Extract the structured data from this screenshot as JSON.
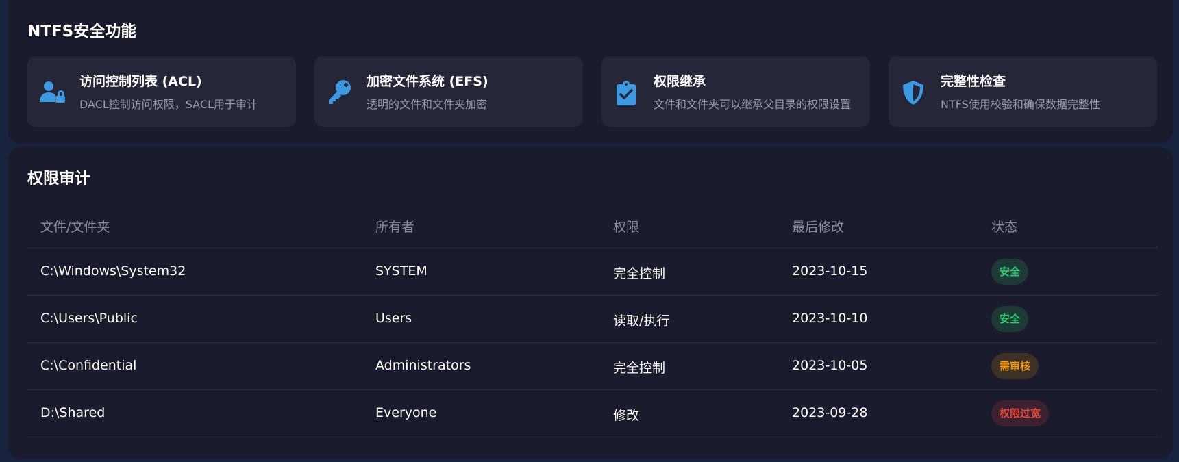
{
  "features": {
    "title": "NTFS安全功能",
    "cards": [
      {
        "icon": "user-lock-icon",
        "title": "访问控制列表 (ACL)",
        "desc": "DACL控制访问权限，SACL用于审计"
      },
      {
        "icon": "key-icon",
        "title": "加密文件系统 (EFS)",
        "desc": "透明的文件和文件夹加密"
      },
      {
        "icon": "clipboard-check-icon",
        "title": "权限继承",
        "desc": "文件和文件夹可以继承父目录的权限设置"
      },
      {
        "icon": "shield-icon",
        "title": "完整性检查",
        "desc": "NTFS使用校验和确保数据完整性"
      }
    ],
    "icon_color": "#3b9ae1"
  },
  "audit": {
    "title": "权限审计",
    "columns": [
      "文件/文件夹",
      "所有者",
      "权限",
      "最后修改",
      "状态"
    ],
    "rows": [
      {
        "path": "C:\\Windows\\System32",
        "owner": "SYSTEM",
        "permission": "完全控制",
        "modified": "2023-10-15",
        "status": "安全",
        "status_color": "#2ecc71",
        "status_bg": "#1d3a36"
      },
      {
        "path": "C:\\Users\\Public",
        "owner": "Users",
        "permission": "读取/执行",
        "modified": "2023-10-10",
        "status": "安全",
        "status_color": "#2ecc71",
        "status_bg": "#1d3a36"
      },
      {
        "path": "C:\\Confidential",
        "owner": "Administrators",
        "permission": "完全控制",
        "modified": "2023-10-05",
        "status": "需审核",
        "status_color": "#f39c12",
        "status_bg": "#3d3126"
      },
      {
        "path": "D:\\Shared",
        "owner": "Everyone",
        "permission": "修改",
        "modified": "2023-09-28",
        "status": "权限过宽",
        "status_color": "#e74c3c",
        "status_bg": "#3d2130"
      }
    ]
  }
}
